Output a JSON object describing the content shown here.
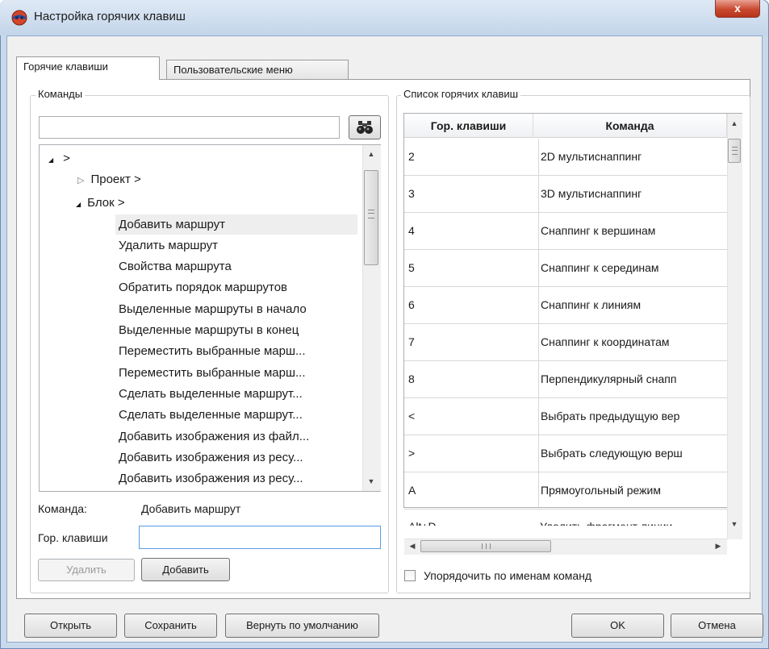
{
  "window": {
    "title": "Настройка горячих клавиш",
    "close_label": "x"
  },
  "tabs": [
    {
      "label": "Горячие клавиши"
    },
    {
      "label": "Пользовательские меню"
    }
  ],
  "commands_group": {
    "label": "Команды",
    "search_value": "",
    "tree": [
      {
        "label": ">",
        "expander": "◢"
      },
      {
        "label": "Проект >",
        "expander": "▷"
      },
      {
        "label": "Блок >",
        "expander": "◢"
      },
      {
        "label": "Добавить маршрут"
      },
      {
        "label": "Удалить маршрут"
      },
      {
        "label": "Свойства маршрута"
      },
      {
        "label": "Обратить порядок маршрутов"
      },
      {
        "label": "Выделенные маршруты в начало"
      },
      {
        "label": "Выделенные маршруты в конец"
      },
      {
        "label": "Переместить выбранные марш..."
      },
      {
        "label": "Переместить выбранные марш..."
      },
      {
        "label": "Сделать выделенные маршрут..."
      },
      {
        "label": "Сделать выделенные маршрут..."
      },
      {
        "label": "Добавить изображения из файл..."
      },
      {
        "label": "Добавить изображения из ресу..."
      },
      {
        "label": "Добавить изображения из ресу..."
      }
    ],
    "command_label": "Команда:",
    "command_value": "Добавить маршрут",
    "hotkey_label": "Гор. клавиши",
    "hotkey_value": "",
    "delete_label": "Удалить",
    "add_label": "Добавить"
  },
  "hotkeys_group": {
    "label": "Список горячих клавиш",
    "columns": [
      "Гор. клавиши",
      "Команда"
    ],
    "rows": [
      {
        "key": "2",
        "command": "2D мультиснаппинг"
      },
      {
        "key": "3",
        "command": "3D мультиснаппинг"
      },
      {
        "key": "4",
        "command": "Снаппинг к вершинам"
      },
      {
        "key": "5",
        "command": "Снаппинг к серединам"
      },
      {
        "key": "6",
        "command": "Снаппинг к линиям"
      },
      {
        "key": "7",
        "command": "Снаппинг к координатам"
      },
      {
        "key": "8",
        "command": "Перпендикулярный снапп"
      },
      {
        "key": "<",
        "command": "Выбрать предыдущую вер"
      },
      {
        "key": ">",
        "command": "Выбрать следующую верш"
      },
      {
        "key": "A",
        "command": "Прямоугольный режим"
      },
      {
        "key": "Alt+D",
        "command": "Удалить фрагмент линии"
      }
    ],
    "sort_label": "Упорядочить по именам команд",
    "sort_checked": false
  },
  "footer": {
    "open_label": "Открыть",
    "save_label": "Сохранить",
    "reset_label": "Вернуть по умолчанию",
    "ok_label": "OK",
    "cancel_label": "Отмена"
  }
}
